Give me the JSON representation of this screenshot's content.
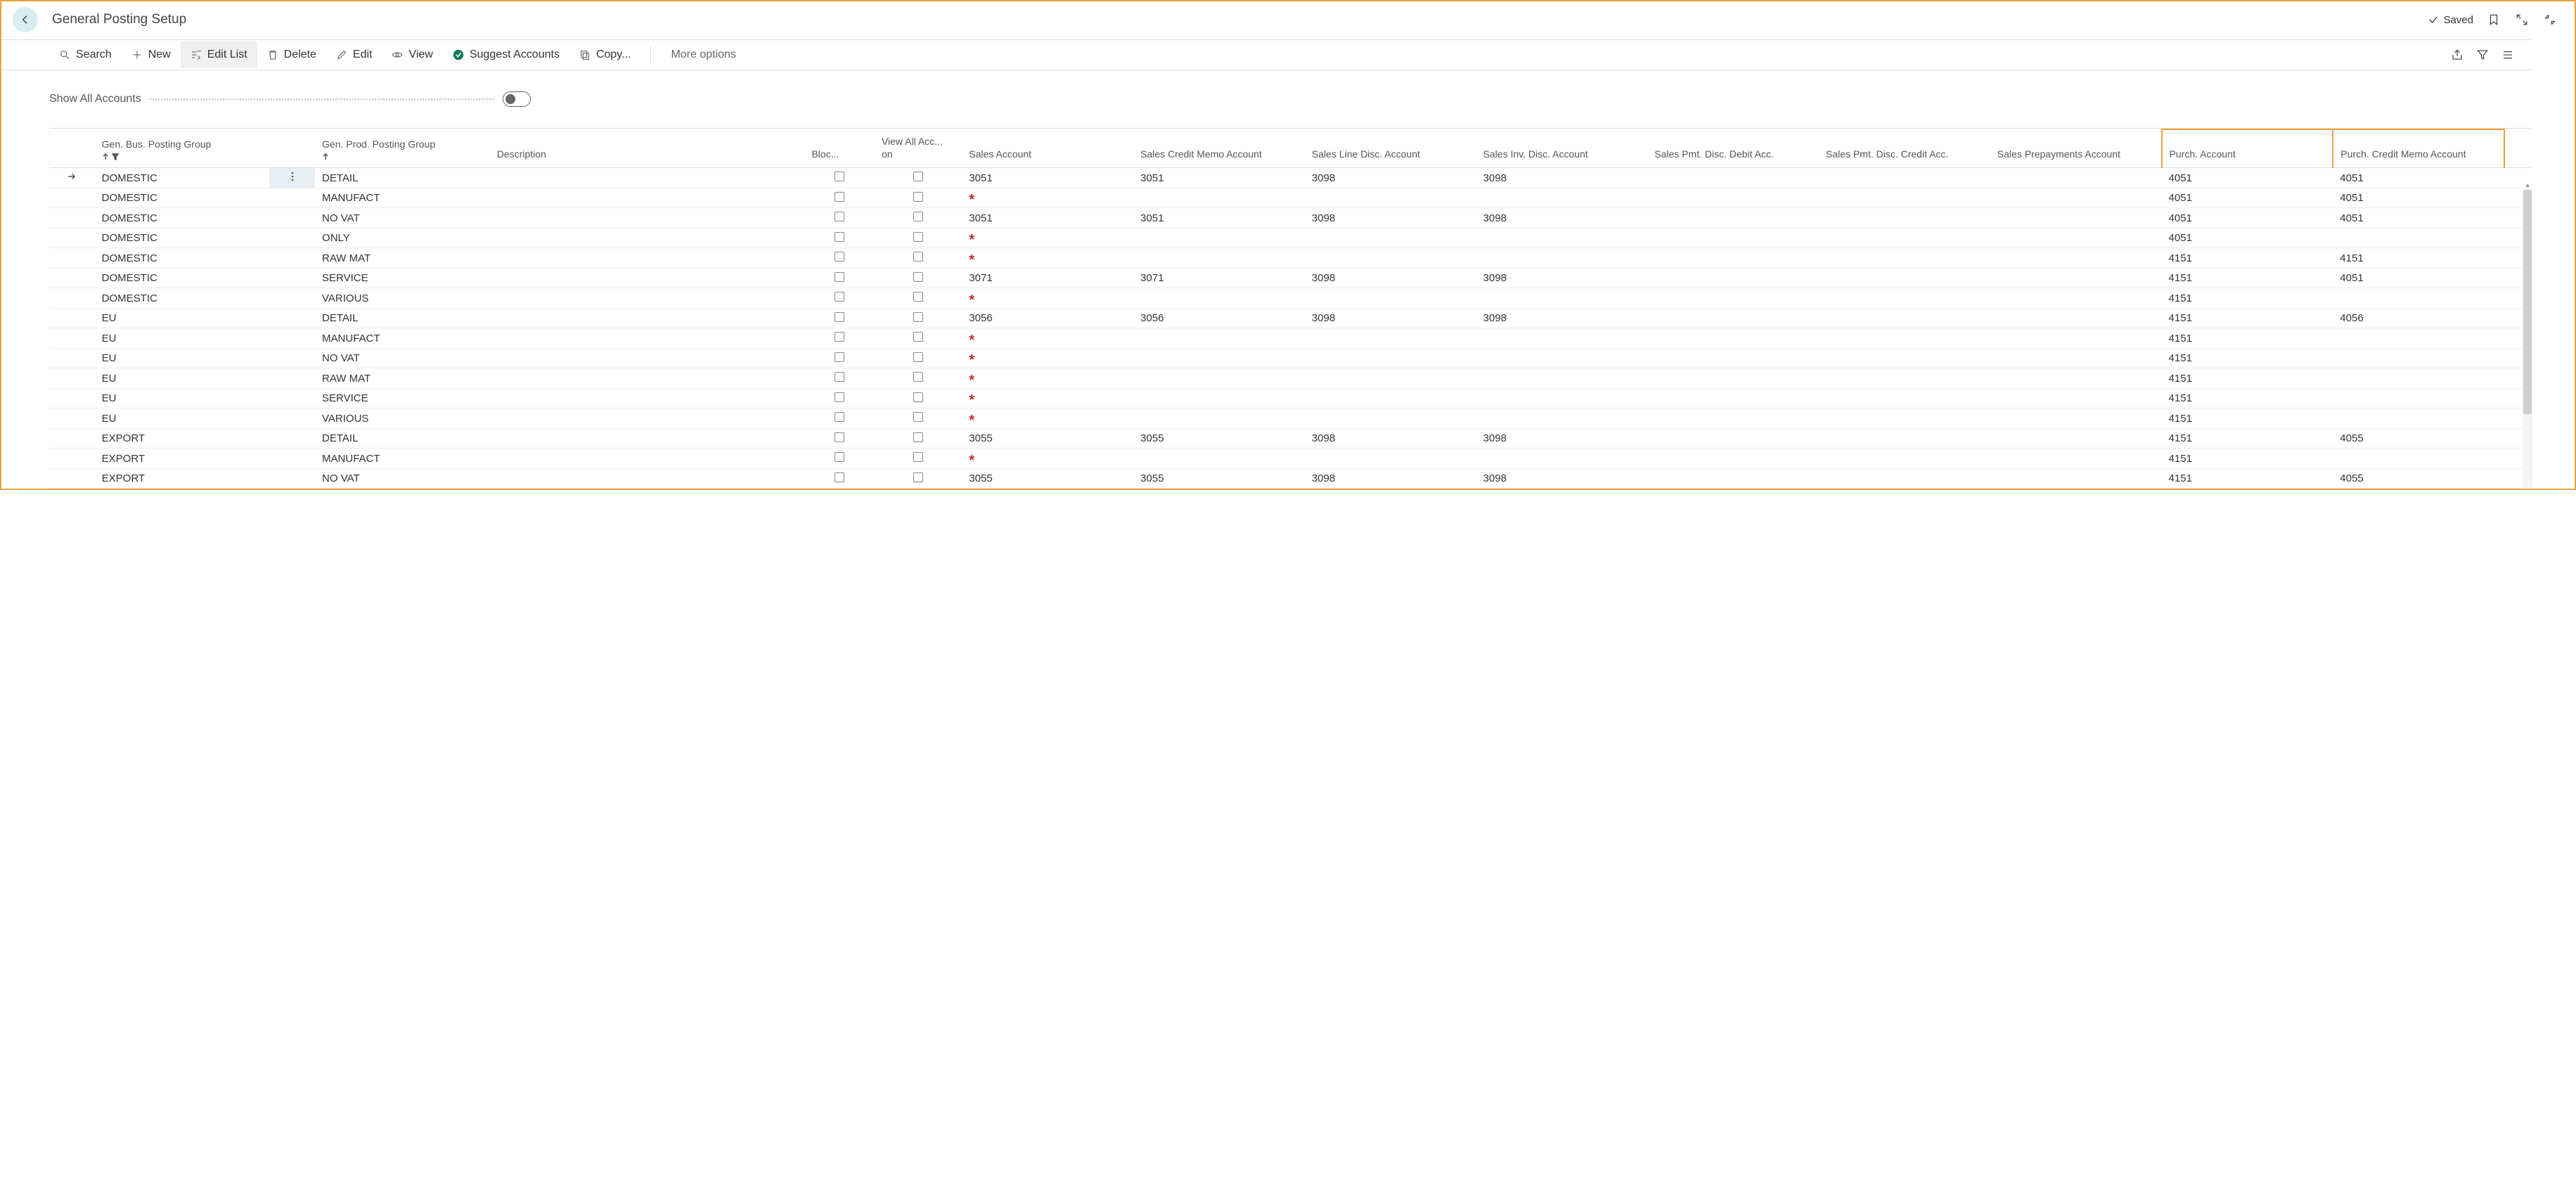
{
  "header": {
    "title": "General Posting Setup",
    "saved_label": "Saved"
  },
  "toolbar": {
    "search": "Search",
    "new": "New",
    "edit_list": "Edit List",
    "delete": "Delete",
    "edit": "Edit",
    "view": "View",
    "suggest": "Suggest Accounts",
    "copy": "Copy...",
    "more": "More options"
  },
  "show_all_label": "Show All Accounts",
  "columns": {
    "bus_grp": "Gen. Bus. Posting Group",
    "prod_grp": "Gen. Prod. Posting Group",
    "desc": "Description",
    "blocked": "Bloc...",
    "view_all": "View All Acc... on",
    "sales_acc": "Sales Account",
    "sales_credit": "Sales Credit Memo Account",
    "sales_line_disc": "Sales Line Disc. Account",
    "sales_inv_disc": "Sales Inv. Disc. Account",
    "sales_pmt_debit": "Sales Pmt. Disc. Debit Acc.",
    "sales_pmt_credit": "Sales Pmt. Disc. Credit Acc.",
    "sales_prepay": "Sales Prepayments Account",
    "purch_acc": "Purch. Account",
    "purch_credit": "Purch. Credit Memo Account"
  },
  "rows": [
    {
      "bus": "DOMESTIC",
      "prod": "DETAIL",
      "sales": "3051",
      "scredit": "3051",
      "slined": "3098",
      "sinvd": "3098",
      "purch": "4051",
      "pcredit": "4051",
      "selected": true
    },
    {
      "bus": "DOMESTIC",
      "prod": "MANUFACT",
      "sales": "*",
      "purch": "4051",
      "pcredit": "4051"
    },
    {
      "bus": "DOMESTIC",
      "prod": "NO VAT",
      "sales": "3051",
      "scredit": "3051",
      "slined": "3098",
      "sinvd": "3098",
      "purch": "4051",
      "pcredit": "4051"
    },
    {
      "bus": "DOMESTIC",
      "prod": "ONLY",
      "sales": "*",
      "purch": "4051"
    },
    {
      "bus": "DOMESTIC",
      "prod": "RAW MAT",
      "sales": "*",
      "purch": "4151",
      "pcredit": "4151"
    },
    {
      "bus": "DOMESTIC",
      "prod": "SERVICE",
      "sales": "3071",
      "scredit": "3071",
      "slined": "3098",
      "sinvd": "3098",
      "purch": "4151",
      "pcredit": "4051"
    },
    {
      "bus": "DOMESTIC",
      "prod": "VARIOUS",
      "sales": "*",
      "purch": "4151"
    },
    {
      "bus": "EU",
      "prod": "DETAIL",
      "sales": "3056",
      "scredit": "3056",
      "slined": "3098",
      "sinvd": "3098",
      "purch": "4151",
      "pcredit": "4056"
    },
    {
      "bus": "EU",
      "prod": "MANUFACT",
      "sales": "*",
      "purch": "4151"
    },
    {
      "bus": "EU",
      "prod": "NO VAT",
      "sales": "*",
      "purch": "4151"
    },
    {
      "bus": "EU",
      "prod": "RAW MAT",
      "sales": "*",
      "purch": "4151"
    },
    {
      "bus": "EU",
      "prod": "SERVICE",
      "sales": "*",
      "purch": "4151"
    },
    {
      "bus": "EU",
      "prod": "VARIOUS",
      "sales": "*",
      "purch": "4151"
    },
    {
      "bus": "EXPORT",
      "prod": "DETAIL",
      "sales": "3055",
      "scredit": "3055",
      "slined": "3098",
      "sinvd": "3098",
      "purch": "4151",
      "pcredit": "4055"
    },
    {
      "bus": "EXPORT",
      "prod": "MANUFACT",
      "sales": "*",
      "purch": "4151"
    },
    {
      "bus": "EXPORT",
      "prod": "NO VAT",
      "sales": "3055",
      "scredit": "3055",
      "slined": "3098",
      "sinvd": "3098",
      "purch": "4151",
      "pcredit": "4055"
    }
  ]
}
